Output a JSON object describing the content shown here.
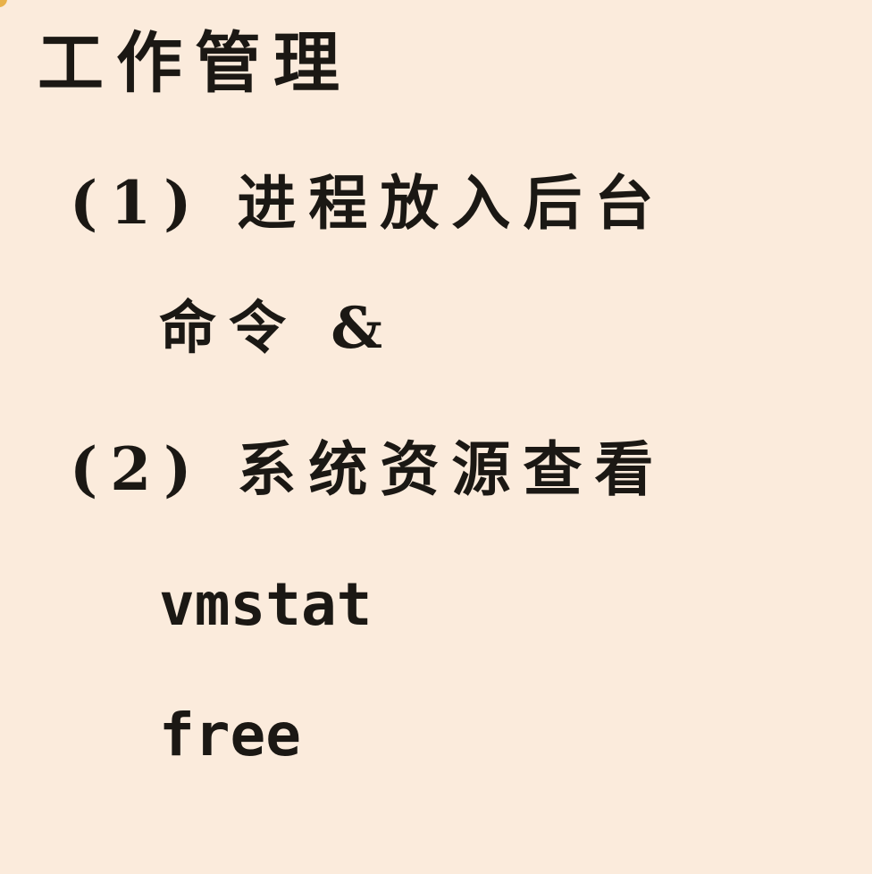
{
  "title": "工作管理",
  "items": [
    {
      "number": "(1)",
      "label": "进程放入后台",
      "commands": [
        "命令 &"
      ]
    },
    {
      "number": "(2)",
      "label": "系统资源查看",
      "commands": [
        "vmstat",
        "free"
      ]
    }
  ]
}
